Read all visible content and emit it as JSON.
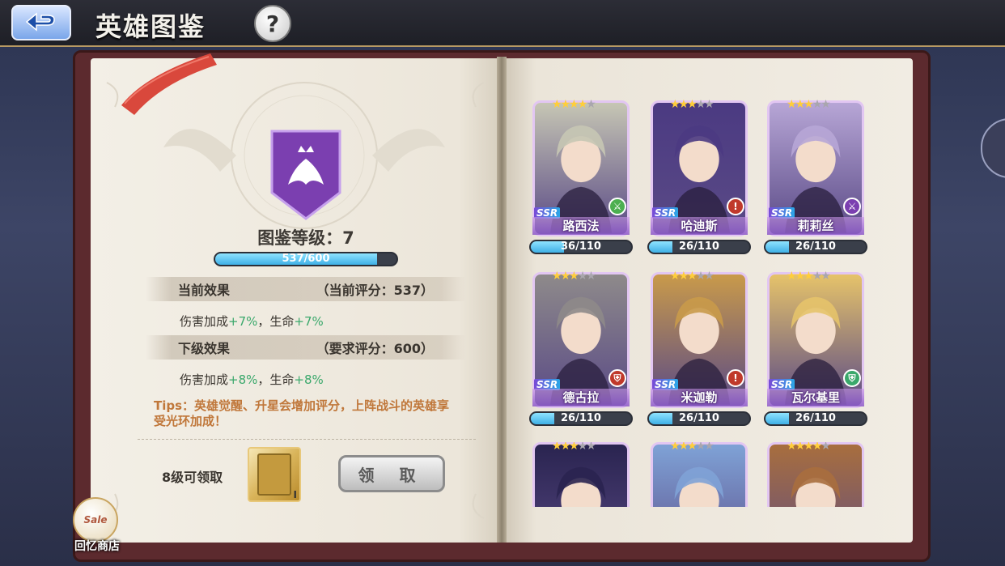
{
  "header": {
    "title": "英雄图鉴",
    "help_label": "?"
  },
  "collection": {
    "level_label": "图鉴等级：7",
    "xp_text": "537/600",
    "xp_fraction": 0.895
  },
  "current_effect": {
    "title": "当前效果",
    "score_label": "（当前评分：537）",
    "damage_label": "伤害加成",
    "damage_value": "+7%",
    "sep": "，",
    "life_label": "生命",
    "life_value": "+7%"
  },
  "next_effect": {
    "title": "下级效果",
    "score_label": "（要求评分：600）",
    "damage_label": "伤害加成",
    "damage_value": "+8%",
    "sep": "，",
    "life_label": "生命",
    "life_value": "+8%"
  },
  "tips": "Tips：英雄觉醒、升星会增加评分，上阵战斗的英雄享受光环加成！",
  "reward": {
    "label": "8级可领取",
    "count": "I",
    "claim_label": "领 取"
  },
  "shop": {
    "badge": "Sale",
    "label": "回忆商店"
  },
  "heroes": [
    {
      "name": "路西法",
      "rarity": "SSR",
      "stars": 4,
      "max_stars": 5,
      "progress": "36/110",
      "fraction": 0.327,
      "class_icon": "sword-icon",
      "class_color": "#4caf50",
      "tint": "#c6c6b4"
    },
    {
      "name": "哈迪斯",
      "rarity": "SSR",
      "stars": 3,
      "max_stars": 5,
      "progress": "26/110",
      "fraction": 0.236,
      "class_icon": "exclaim-icon",
      "class_color": "#c0392b",
      "tint": "#4b3a82"
    },
    {
      "name": "莉莉丝",
      "rarity": "SSR",
      "stars": 3,
      "max_stars": 5,
      "progress": "26/110",
      "fraction": 0.236,
      "class_icon": "sword-icon",
      "class_color": "#7b3fb0",
      "tint": "#b7a6d6"
    },
    {
      "name": "德古拉",
      "rarity": "SSR",
      "stars": 3,
      "max_stars": 5,
      "progress": "26/110",
      "fraction": 0.236,
      "class_icon": "shield-icon",
      "class_color": "#c0392b",
      "tint": "#8e8a8a"
    },
    {
      "name": "米迦勒",
      "rarity": "SSR",
      "stars": 3,
      "max_stars": 5,
      "progress": "26/110",
      "fraction": 0.236,
      "class_icon": "exclaim-icon",
      "class_color": "#c0392b",
      "tint": "#c99a4a"
    },
    {
      "name": "瓦尔基里",
      "rarity": "SSR",
      "stars": 3,
      "max_stars": 5,
      "progress": "26/110",
      "fraction": 0.236,
      "class_icon": "shield-icon",
      "class_color": "#3aa86b",
      "tint": "#e6c36a"
    },
    {
      "name": "",
      "rarity": "",
      "stars": 3,
      "max_stars": 5,
      "progress": "",
      "fraction": 0,
      "class_icon": "",
      "class_color": "",
      "tint": "#2a2450"
    },
    {
      "name": "",
      "rarity": "",
      "stars": 3,
      "max_stars": 5,
      "progress": "",
      "fraction": 0,
      "class_icon": "",
      "class_color": "",
      "tint": "#7fa2d6"
    },
    {
      "name": "",
      "rarity": "",
      "stars": 4,
      "max_stars": 5,
      "progress": "",
      "fraction": 0,
      "class_icon": "",
      "class_color": "",
      "tint": "#a86e3e"
    }
  ]
}
